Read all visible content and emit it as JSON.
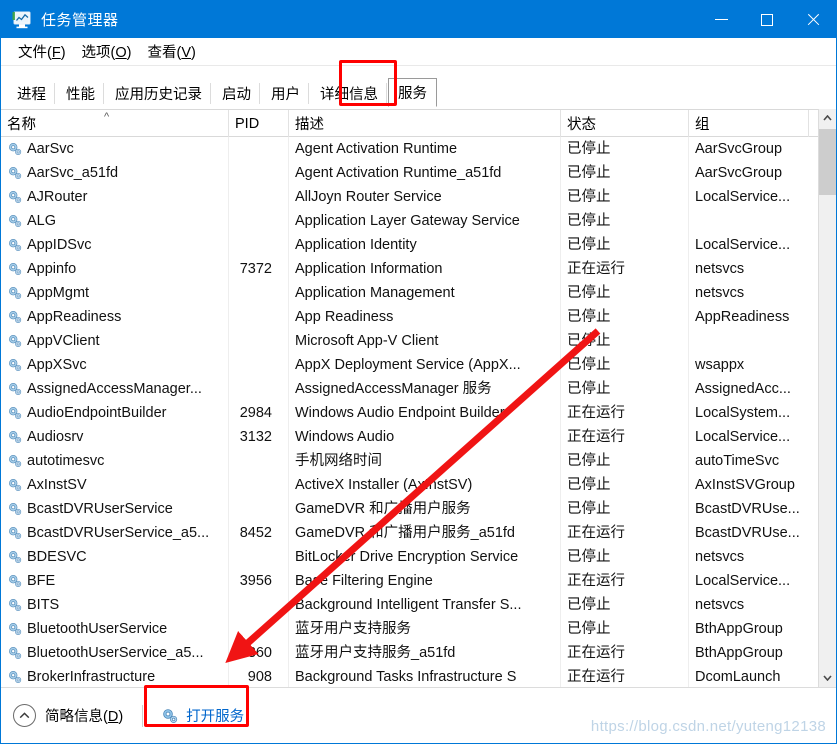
{
  "window": {
    "title": "任务管理器",
    "app_icon": "task-manager-icon",
    "minimize": "−",
    "maximize": "□",
    "close": "✕",
    "titlebar_color": "#0078d7"
  },
  "menu": [
    {
      "label": "文件(F)",
      "mnemonic": "F"
    },
    {
      "label": "选项(O)",
      "mnemonic": "O"
    },
    {
      "label": "查看(V)",
      "mnemonic": "V"
    }
  ],
  "tabs": [
    {
      "label": "进程",
      "active": false
    },
    {
      "label": "性能",
      "active": false
    },
    {
      "label": "应用历史记录",
      "active": false
    },
    {
      "label": "启动",
      "active": false
    },
    {
      "label": "用户",
      "active": false
    },
    {
      "label": "详细信息",
      "active": false
    },
    {
      "label": "服务",
      "active": true
    }
  ],
  "table": {
    "columns": [
      {
        "key": "name",
        "label": "名称",
        "sorted": true,
        "sort_caret": "^"
      },
      {
        "key": "pid",
        "label": "PID"
      },
      {
        "key": "desc",
        "label": "描述"
      },
      {
        "key": "status",
        "label": "状态"
      },
      {
        "key": "group",
        "label": "组"
      }
    ],
    "rows": [
      {
        "name": "AarSvc",
        "pid": "",
        "desc": "Agent Activation Runtime",
        "status": "已停止",
        "group": "AarSvcGroup"
      },
      {
        "name": "AarSvc_a51fd",
        "pid": "",
        "desc": "Agent Activation Runtime_a51fd",
        "status": "已停止",
        "group": "AarSvcGroup"
      },
      {
        "name": "AJRouter",
        "pid": "",
        "desc": "AllJoyn Router Service",
        "status": "已停止",
        "group": "LocalService..."
      },
      {
        "name": "ALG",
        "pid": "",
        "desc": "Application Layer Gateway Service",
        "status": "已停止",
        "group": ""
      },
      {
        "name": "AppIDSvc",
        "pid": "",
        "desc": "Application Identity",
        "status": "已停止",
        "group": "LocalService..."
      },
      {
        "name": "Appinfo",
        "pid": "7372",
        "desc": "Application Information",
        "status": "正在运行",
        "group": "netsvcs"
      },
      {
        "name": "AppMgmt",
        "pid": "",
        "desc": "Application Management",
        "status": "已停止",
        "group": "netsvcs"
      },
      {
        "name": "AppReadiness",
        "pid": "",
        "desc": "App Readiness",
        "status": "已停止",
        "group": "AppReadiness"
      },
      {
        "name": "AppVClient",
        "pid": "",
        "desc": "Microsoft App-V Client",
        "status": "已停止",
        "group": ""
      },
      {
        "name": "AppXSvc",
        "pid": "",
        "desc": "AppX Deployment Service (AppX...",
        "status": "已停止",
        "group": "wsappx"
      },
      {
        "name": "AssignedAccessManager...",
        "pid": "",
        "desc": "AssignedAccessManager 服务",
        "status": "已停止",
        "group": "AssignedAcc..."
      },
      {
        "name": "AudioEndpointBuilder",
        "pid": "2984",
        "desc": "Windows Audio Endpoint Builder",
        "status": "正在运行",
        "group": "LocalSystem..."
      },
      {
        "name": "Audiosrv",
        "pid": "3132",
        "desc": "Windows Audio",
        "status": "正在运行",
        "group": "LocalService..."
      },
      {
        "name": "autotimesvc",
        "pid": "",
        "desc": "手机网络时间",
        "status": "已停止",
        "group": "autoTimeSvc"
      },
      {
        "name": "AxInstSV",
        "pid": "",
        "desc": "ActiveX Installer (AxInstSV)",
        "status": "已停止",
        "group": "AxInstSVGroup"
      },
      {
        "name": "BcastDVRUserService",
        "pid": "",
        "desc": "GameDVR 和广播用户服务",
        "status": "已停止",
        "group": "BcastDVRUse..."
      },
      {
        "name": "BcastDVRUserService_a5...",
        "pid": "8452",
        "desc": "GameDVR 和广播用户服务_a51fd",
        "status": "正在运行",
        "group": "BcastDVRUse..."
      },
      {
        "name": "BDESVC",
        "pid": "",
        "desc": "BitLocker Drive Encryption Service",
        "status": "已停止",
        "group": "netsvcs"
      },
      {
        "name": "BFE",
        "pid": "3956",
        "desc": "Base Filtering Engine",
        "status": "正在运行",
        "group": "LocalService..."
      },
      {
        "name": "BITS",
        "pid": "",
        "desc": "Background Intelligent Transfer S...",
        "status": "已停止",
        "group": "netsvcs"
      },
      {
        "name": "BluetoothUserService",
        "pid": "",
        "desc": "蓝牙用户支持服务",
        "status": "已停止",
        "group": "BthAppGroup"
      },
      {
        "name": "BluetoothUserService_a5...",
        "pid": "860",
        "desc": "蓝牙用户支持服务_a51fd",
        "status": "正在运行",
        "group": "BthAppGroup"
      },
      {
        "name": "BrokerInfrastructure",
        "pid": "908",
        "desc": "Background Tasks Infrastructure S",
        "status": "正在运行",
        "group": "DcomLaunch"
      }
    ]
  },
  "scrollbar": {
    "up_arrow": "⌃",
    "down_arrow": "⌄"
  },
  "statusbar": {
    "fewer_details_label": "简略信息(D)",
    "fewer_details_mnemonic": "D",
    "chevron": "⌃",
    "open_services_label": "打开服务",
    "open_services_icon": "services-gear-icon"
  },
  "annotations": {
    "highlight_color": "#ff0000",
    "arrow_color": "#ff0000",
    "watermark": "https://blog.csdn.net/yuteng12138"
  }
}
